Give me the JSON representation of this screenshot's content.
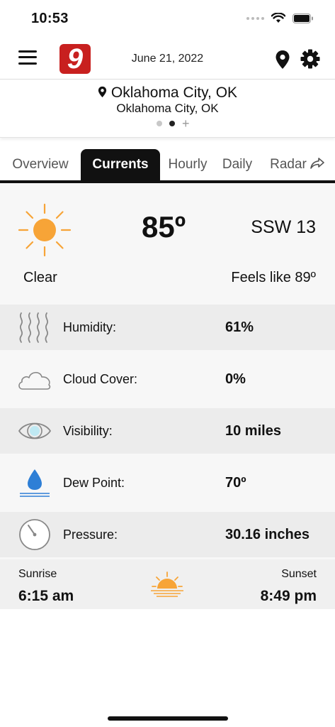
{
  "status": {
    "time": "10:53"
  },
  "header": {
    "logo_text": "9",
    "date": "June 21, 2022"
  },
  "location": {
    "primary": "Oklahoma City, OK",
    "secondary": "Oklahoma City, OK"
  },
  "tabs": [
    {
      "label": "Overview",
      "active": false
    },
    {
      "label": "Currents",
      "active": true
    },
    {
      "label": "Hourly",
      "active": false
    },
    {
      "label": "Daily",
      "active": false
    },
    {
      "label": "Radar",
      "active": false
    }
  ],
  "current": {
    "temperature": "85º",
    "wind": "SSW 13",
    "condition": "Clear",
    "feels_like": "Feels like 89º"
  },
  "details": [
    {
      "label": "Humidity:",
      "value": "61%",
      "icon": "humidity-icon"
    },
    {
      "label": "Cloud Cover:",
      "value": "0%",
      "icon": "cloud-icon"
    },
    {
      "label": "Visibility:",
      "value": "10 miles",
      "icon": "eye-icon"
    },
    {
      "label": "Dew Point:",
      "value": "70º",
      "icon": "water-drop-icon"
    },
    {
      "label": "Pressure:",
      "value": "30.16 inches",
      "icon": "gauge-icon"
    }
  ],
  "sun": {
    "sunrise_label": "Sunrise",
    "sunrise_time": "6:15 am",
    "sunset_label": "Sunset",
    "sunset_time": "8:49 pm"
  },
  "colors": {
    "sun": "#f7a437",
    "drop": "#2e7fd6",
    "logo": "#c8201f"
  }
}
